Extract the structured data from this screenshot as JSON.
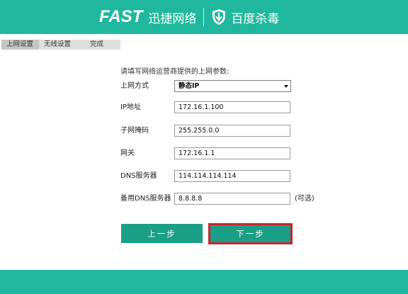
{
  "header": {
    "brand_fast": "FAST",
    "brand_cn": "迅捷网络",
    "partner_label": "百度杀毒",
    "accent_color": "#1fb89e"
  },
  "steps": [
    {
      "label": "上网设置",
      "active": true
    },
    {
      "label": "无线设置",
      "active": false
    },
    {
      "label": "完成",
      "active": false
    }
  ],
  "form": {
    "instruction": "请填写网络运营商提供的上网参数:",
    "connection_type": {
      "label": "上网方式",
      "value": "静态IP"
    },
    "ip": {
      "label": "IP地址",
      "value": "172.16.1.100"
    },
    "subnet": {
      "label": "子网掩码",
      "value": "255.255.0.0"
    },
    "gateway": {
      "label": "网关",
      "value": "172.16.1.1"
    },
    "dns": {
      "label": "DNS服务器",
      "value": "114.114.114.114"
    },
    "dns_backup": {
      "label": "备用DNS服务器",
      "value": "8.8.8.8",
      "optional_note": "(可选)"
    }
  },
  "buttons": {
    "prev_label": "上一步",
    "next_label": "下一步",
    "highlight_color": "#c8252d"
  }
}
